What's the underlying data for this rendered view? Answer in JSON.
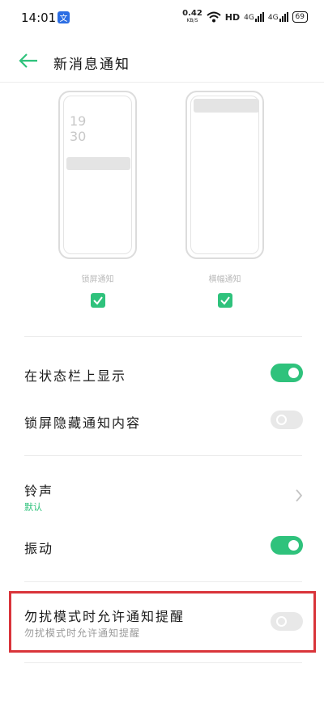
{
  "status_bar": {
    "time": "14:01",
    "app_icon": "文",
    "net_speed_value": "0.42",
    "net_speed_unit": "KB/S",
    "hd_label": "HD",
    "signal1_label": "4G",
    "signal2_label": "4G",
    "battery": "69"
  },
  "header": {
    "title": "新消息通知",
    "back_icon": "arrow-left-icon"
  },
  "previews": {
    "lockscreen": {
      "time_hour": "19",
      "time_minute": "30",
      "label": "锁屏通知",
      "checked": true
    },
    "banner": {
      "label": "横幅通知",
      "checked": true
    }
  },
  "settings": {
    "status_bar_show": {
      "label": "在状态栏上显示",
      "enabled": true
    },
    "lockscreen_hide": {
      "label": "锁屏隐藏通知内容",
      "enabled": false
    },
    "ringtone": {
      "label": "铃声",
      "value": "默认"
    },
    "vibrate": {
      "label": "振动",
      "enabled": true
    },
    "dnd_allow": {
      "label": "勿扰模式时允许通知提醒",
      "description": "勿扰模式时允许通知提醒",
      "enabled": false
    }
  },
  "colors": {
    "accent": "#2fc27c",
    "highlight": "#d9343a"
  }
}
